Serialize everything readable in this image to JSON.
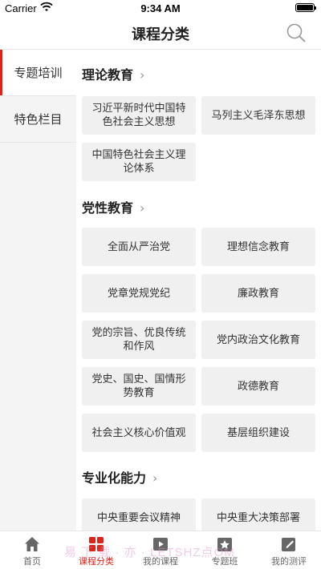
{
  "status": {
    "carrier": "Carrier",
    "time": "9:34 AM"
  },
  "header": {
    "title": "课程分类"
  },
  "sidebar": {
    "items": [
      {
        "label": "专题培训"
      },
      {
        "label": "特色栏目"
      }
    ]
  },
  "sections": [
    {
      "title": "理论教育",
      "cards": [
        "习近平新时代中国特色社会主义思想",
        "马列主义毛泽东思想",
        "中国特色社会主义理论体系"
      ]
    },
    {
      "title": "党性教育",
      "cards": [
        "全面从严治党",
        "理想信念教育",
        "党章党规党纪",
        "廉政教育",
        "党的宗旨、优良传统和作风",
        "党内政治文化教育",
        "党史、国史、国情形势教育",
        "政德教育",
        "社会主义核心价值观",
        "基层组织建设"
      ]
    },
    {
      "title": "专业化能力",
      "cards": [
        "中央重要会议精神",
        "中央重大决策部署"
      ]
    }
  ],
  "tabs": [
    {
      "label": "首页"
    },
    {
      "label": "课程分类"
    },
    {
      "label": "我的课程"
    },
    {
      "label": "专题班"
    },
    {
      "label": "我的测评"
    }
  ],
  "watermark": "易 下 载 · 亦 · LETSHZ点OM",
  "colors": {
    "accent": "#d9261c",
    "card_bg": "#f0f0f0",
    "sidebar_bg": "#f4f4f4"
  }
}
